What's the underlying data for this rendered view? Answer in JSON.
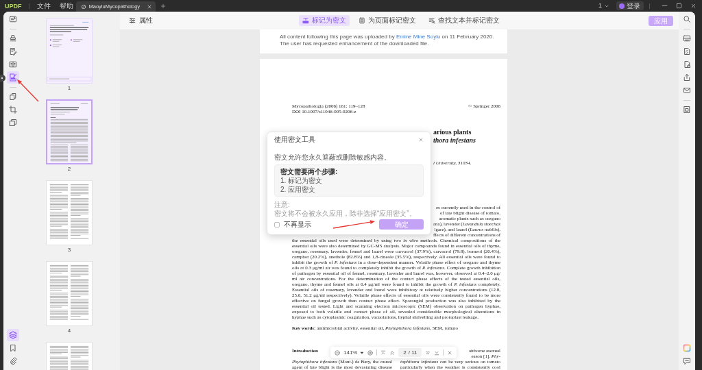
{
  "title_bar": {
    "logo": "UPDF",
    "menus": [
      "文件",
      "帮助"
    ],
    "tabs": [
      {
        "title": "MaoyluMycopathology",
        "selected": true
      }
    ],
    "window_count": "1",
    "login": "登录"
  },
  "left_toolbar": {
    "groups": [
      [
        {
          "selected": false
        }
      ],
      [
        {
          "selected": false
        },
        {
          "selected": false
        },
        {
          "selected": false
        },
        {
          "selected": true
        }
      ],
      [
        {
          "selected": false
        },
        {
          "selected": false
        },
        {
          "selected": false
        }
      ]
    ],
    "bottom": [
      {
        "selected": true
      },
      {
        "selected": false
      },
      {
        "selected": false
      }
    ]
  },
  "thumbnails": [
    {
      "label": "1",
      "kind": "cover",
      "selected": false,
      "highlighted": true
    },
    {
      "label": "2",
      "kind": "title",
      "selected": true,
      "highlighted": true
    },
    {
      "label": "3",
      "kind": "text",
      "selected": false,
      "highlighted": false
    },
    {
      "label": "4",
      "kind": "text",
      "selected": false,
      "highlighted": false
    },
    {
      "kind": "text",
      "selected": false,
      "highlighted": false
    }
  ],
  "redaction_toolbar": {
    "properties": "属性",
    "modes": [
      {
        "label": "标记为密文",
        "selected": true
      },
      {
        "label": "为页面标记密文",
        "selected": false
      },
      {
        "label": "查找文本并标记密文",
        "selected": false
      }
    ],
    "apply": {
      "label": "应用",
      "disabled": true
    }
  },
  "document": {
    "previous_page": {
      "upload_note": {
        "before": "All content following this page was uploaded by",
        "link": "Emine Mine Soylu",
        "after": "on 11 February 2020."
      },
      "request_note": "The user has requested enhancement of the downloaded file."
    },
    "page": {
      "journal": "Mycopathologia (2006) 161: 119–128",
      "doi": "DOI 10.1007/s11046-005-0206-z",
      "copyright": "© Springer 2006",
      "title_fragments": [
        {
          "text": "arious plants",
          "italic": false
        },
        {
          "text": "thora infestans",
          "italic": true
        }
      ],
      "affiliation_fragment": "l University, 31034.",
      "abstract_fragments": [
        "es currently used in the control of",
        "of late blight disease of tomato.",
        "aromatic plants such as oregano",
        "ana), lavender (*Lavandula stoechas*",
        "lgare), and laurel (*Laurus nobilis*),",
        "ffects of different concentrations of"
      ],
      "abstract_lines": [
        "the essential oils used were determined by using two *in vitro* methods. Chemical compositions of the",
        "essential oils were also determined by GC-MS analysis. Major compounds found in essential oils of thyme,",
        "oregano, rosemary, lavender, fennel and laurel were carvacrol (37.9%), carvacrol (79.8), borneol (20.4%),",
        "camphor (20.2%), anethole (82.8%) and 1,8-cineole (35.5%), respectively. All essential oils were found to",
        "inhibit the growth of *P. infestans* in a dose-dependent manner. Volatile phase effect of oregano and thyme",
        "oils at 0.3 μg/ml air was found to completely inhibit the growth of *P. infestans*. Complete growth inhibition",
        "of pathogen by essential oil of fennel, rosemary, lavender and laurel was, however, observed at 0.4–2.0 μg/",
        "ml air concentrations. For the determination of the contact phase effects of the tested essential oils,",
        "oregano, thyme and fennel oils at 6.4 μg/ml were found to inhibit the growth of *P. infestans* completely.",
        "Essential oils of rosemary, lavender and laurel were inhibitory at relatively higher concentrations (12.8,",
        "25.6, 51.2 μg/ml respectively). Volatile phase effects of essential oils were consistently found to be more",
        "effective on fungal growth than contact phase effect. Sporangial production was also inhibited by the",
        "essential oil tested. Light and scanning electron microscopic (SEM) observation on pathogen hyphae,",
        "exposed to both volatile and contact phase of oil, revealed considerable morphological alterations in",
        "hyphae such as cytoplasmic coagulation, vacuolations, hyphal shrivelling and protoplast leakage."
      ],
      "keywords": "**Key words:** antimicrobial activity, essential oil, *Phytophthora infestans*, SEM, tomato",
      "section_heading": "Introduction",
      "left_column": [
        "*Phytophthora infestans* (Mont.) de Bary, the causal",
        "agent of late blight is the most devastating disease"
      ],
      "right_column_fragments": [
        "airborne asexual",
        "eason [1]. *Phy-*"
      ],
      "right_column": [
        "*tophthora infestans* can be very serious on tomato",
        "particularly when the weather is consistently cool"
      ]
    }
  },
  "zoom_bar": {
    "zoom": "141%",
    "page": "2",
    "page_total": "/ 11"
  },
  "dialog": {
    "title": "使用密文工具",
    "intro": "密文允许您永久遮蔽或删除敏感内容。",
    "steps_title": "密文需要两个步骤:",
    "steps": [
      "1. 标记为密文",
      "2. 应用密文"
    ],
    "note_label": "注意:",
    "note": "密文将不会被永久应用，除非选择“应用密文”。",
    "dont_show_again": {
      "label": "不再显示",
      "checked": false
    },
    "confirm": "确定"
  }
}
